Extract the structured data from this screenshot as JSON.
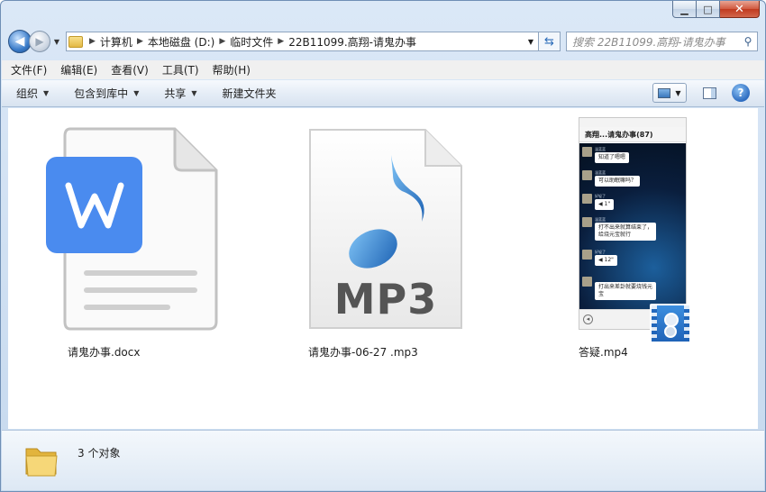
{
  "window": {
    "caption": {
      "minimize_glyph": "▁",
      "maximize_glyph": "□",
      "close_glyph": "✕"
    }
  },
  "address": {
    "back_glyph": "◀",
    "forward_glyph": "▶",
    "crumbs": [
      "计算机",
      "本地磁盘 (D:)",
      "临时文件",
      "22B11099.高翔-请鬼办事"
    ],
    "search_placeholder": "搜索 22B11099.高翔-请鬼办事"
  },
  "menubar": {
    "items": [
      "文件(F)",
      "编辑(E)",
      "查看(V)",
      "工具(T)",
      "帮助(H)"
    ]
  },
  "toolbar": {
    "organize": "组织",
    "include_in_library": "包含到库中",
    "share": "共享",
    "new_folder": "新建文件夹",
    "help_glyph": "?"
  },
  "files": [
    {
      "name": "请鬼办事.docx",
      "type": "docx",
      "icon": "word-document-icon"
    },
    {
      "name": "请鬼办事-06-27 .mp3",
      "type": "mp3",
      "icon": "mp3-audio-icon",
      "label": "MP3"
    },
    {
      "name": "答疑.mp4",
      "type": "mp4",
      "icon": "video-thumbnail-icon"
    }
  ],
  "thumbnail": {
    "chat_title": "高翔...请鬼办事(87)",
    "messages": [
      {
        "sender": "温蓝蓝",
        "text": "知道了嗯嗯"
      },
      {
        "sender": "温蓝蓝",
        "text": "可以助眠嘛吗？"
      },
      {
        "sender": "好轻了",
        "text": "◀ 1\""
      },
      {
        "sender": "温蓝蓝",
        "text": "打不出来就算结束了，\n给烧元宝就行"
      },
      {
        "sender": "好轻了",
        "text": "◀ 12\""
      },
      {
        "sender": "",
        "text": "打出来差卦就要烧钱元\n宝"
      }
    ]
  },
  "details": {
    "count_text": "3 个对象"
  },
  "colors": {
    "word_blue": "#4a8bef",
    "mp3_note_blue": "#2f86d6",
    "window_frame": "#dbe8f7"
  }
}
